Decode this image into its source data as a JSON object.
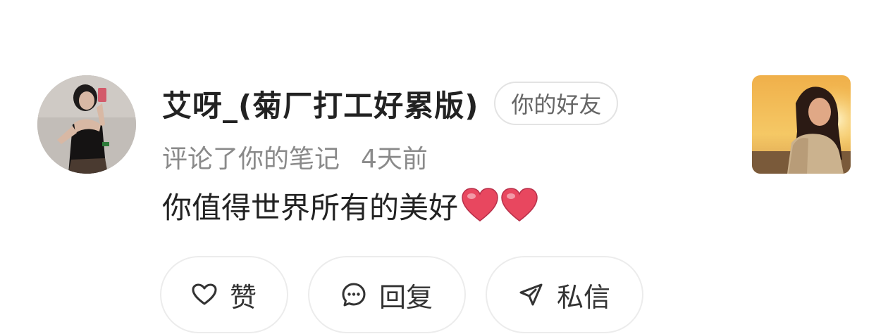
{
  "notification": {
    "username": "艾呀_(菊厂打工好累版)",
    "badge": "你的好友",
    "action_text": "评论了你的笔记",
    "time": "4天前",
    "comment": "你值得世界所有的美好"
  },
  "actions": {
    "like_label": "赞",
    "reply_label": "回复",
    "dm_label": "私信"
  },
  "icons": {
    "like": "heart-outline-icon",
    "reply": "chat-bubble-icon",
    "dm": "send-icon",
    "emoji": "red-heart-emoji"
  },
  "colors": {
    "text": "#222222",
    "secondary_text": "#8a8a8a",
    "badge_text": "#666666",
    "border": "#ececec",
    "heart": "#e8475f"
  }
}
